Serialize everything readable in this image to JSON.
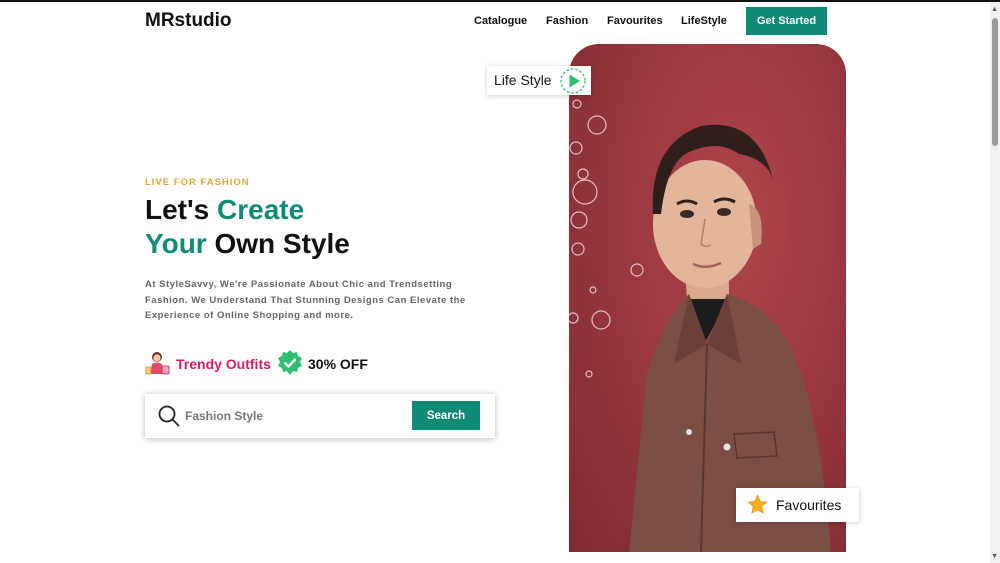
{
  "brand": {
    "name": "MRstudio"
  },
  "nav": {
    "items": [
      {
        "label": "Catalogue"
      },
      {
        "label": "Fashion"
      },
      {
        "label": "Favourites"
      },
      {
        "label": "LifeStyle"
      }
    ],
    "cta_label": "Get Started"
  },
  "hero": {
    "eyebrow": "LIVE FOR FASHION",
    "headline": {
      "line1_a": "Let's ",
      "line1_b": "Create",
      "line2_a": "Your",
      "line2_b": " Own Style"
    },
    "description": "At StyleSavvy, We're Passionate About Chic and Trendsetting Fashion. We Understand That Stunning Designs Can Elevate the Experience of Online Shopping and more.",
    "tags": {
      "trendy_label": "Trendy Outfits",
      "discount_label": "30% OFF",
      "trendy_icon": "person-shopping-icon",
      "discount_icon": "verified-badge-icon"
    },
    "search": {
      "placeholder": "Fashion Style",
      "value": "",
      "button_label": "Search"
    },
    "image": {
      "floating_top_label": "Life Style",
      "floating_top_icon": "play-icon",
      "floating_bottom_label": "Favourites",
      "floating_bottom_icon": "star-icon"
    }
  },
  "colors": {
    "accent": "#0f8a74",
    "eyebrow": "#e9a33a",
    "trendy": "#d81b60",
    "hero_bg": "#9a3840"
  }
}
